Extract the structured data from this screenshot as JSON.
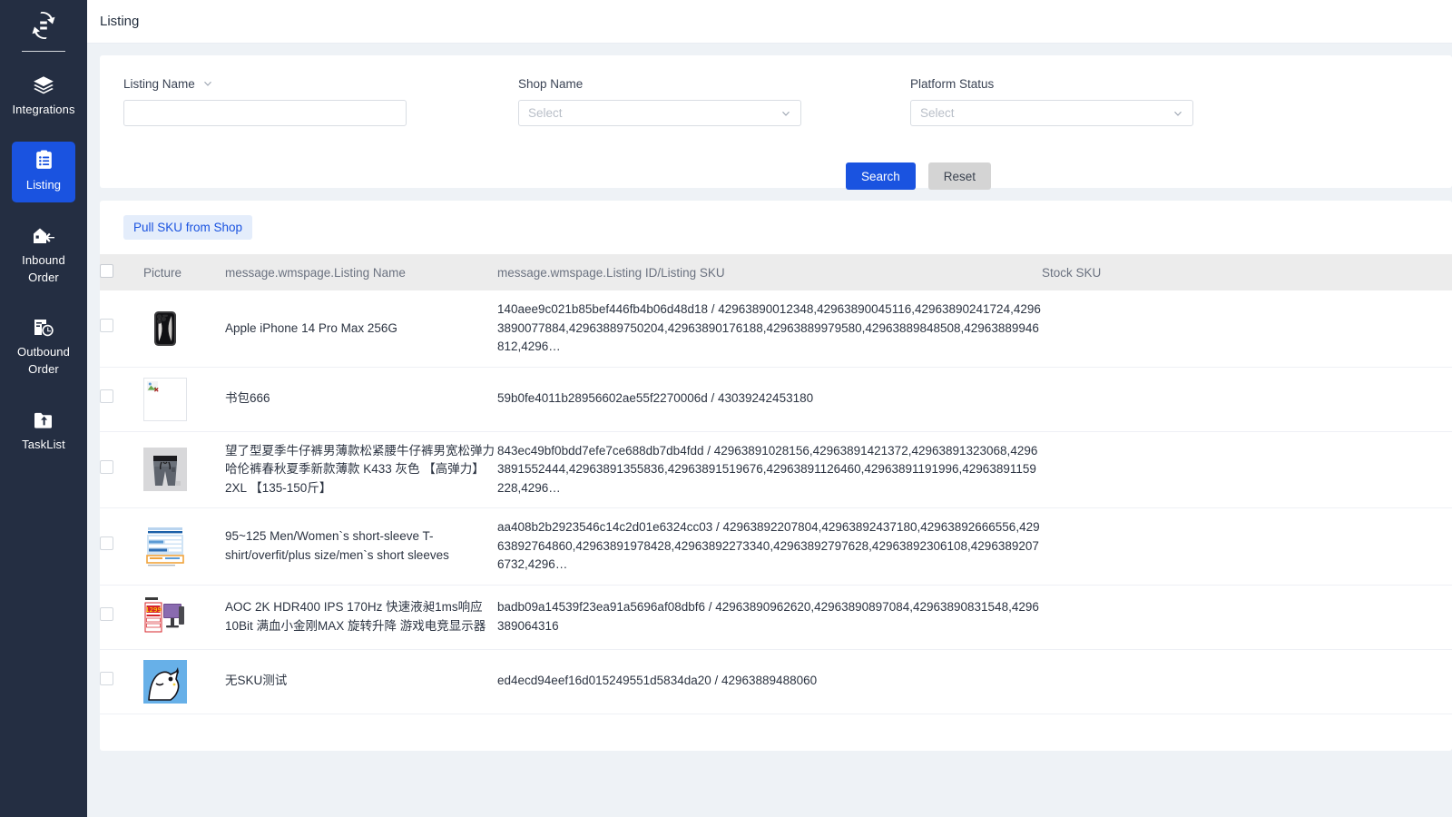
{
  "sidebar": {
    "logo_icon": "brand-sync-logo",
    "items": [
      {
        "id": "integrations",
        "label": "Integrations",
        "icon": "layers-icon",
        "active": false
      },
      {
        "id": "listing",
        "label": "Listing",
        "icon": "clipboard-list-icon",
        "active": true
      },
      {
        "id": "inbound-order",
        "label": "Inbound Order",
        "icon": "warehouse-inbound-icon",
        "active": false
      },
      {
        "id": "outbound-order",
        "label": "Outbound Order",
        "icon": "document-clock-icon",
        "active": false
      },
      {
        "id": "tasklist",
        "label": "TaskList",
        "icon": "folder-upload-icon",
        "active": false
      }
    ]
  },
  "header": {
    "title": "Listing"
  },
  "filters": {
    "listing_name": {
      "label": "Listing Name",
      "caret_icon": "chevron-down-icon",
      "value": "",
      "placeholder": ""
    },
    "shop_name": {
      "label": "Shop Name",
      "value": "",
      "placeholder": "Select",
      "caret_icon": "chevron-down-icon"
    },
    "platform_status": {
      "label": "Platform Status",
      "value": "",
      "placeholder": "Select",
      "caret_icon": "chevron-down-icon"
    },
    "search_label": "Search",
    "reset_label": "Reset",
    "accent_color": "#1a53e0",
    "reset_color": "#d4d4d4"
  },
  "toolbar": {
    "pull_sku_label": "Pull SKU from Shop",
    "pull_sku_bg": "#e4edfb",
    "pull_sku_fg": "#1a53e0"
  },
  "table": {
    "columns": [
      {
        "key": "checkbox",
        "label": ""
      },
      {
        "key": "picture",
        "label": "Picture"
      },
      {
        "key": "name",
        "label": "message.wmspage.Listing Name"
      },
      {
        "key": "id",
        "label": "message.wmspage.Listing ID/Listing SKU"
      },
      {
        "key": "stock_sku",
        "label": "Stock SKU"
      }
    ],
    "rows": [
      {
        "picture": "iphone-14-pro-max-thumbnail",
        "name": "Apple iPhone 14 Pro Max 256G",
        "id": "140aee9c021b85bef446fb4b06d48d18 / 42963890012348,42963890045116,42963890241724,42963890077884,42963889750204,42963890176188,42963889979580,42963889848508,42963889946812,4296…",
        "stock_sku": ""
      },
      {
        "picture": "broken-image-thumbnail",
        "name": "书包666",
        "id": "59b0fe4011b28956602ae55f2270006d / 43039242453180",
        "stock_sku": ""
      },
      {
        "picture": "grey-jeans-thumbnail",
        "name": "望了型夏季牛仔裤男薄款松紧腰牛仔裤男宽松弹力哈伦裤春秋夏季新款薄款 K433 灰色 【高弹力】 2XL 【135-150斤】",
        "id": "843ec49bf0bdd7efe7ce688db7db4fdd / 42963891028156,42963891421372,42963891323068,42963891552444,42963891355836,42963891519676,42963891126460,42963891191996,42963891159228,4296…",
        "stock_sku": ""
      },
      {
        "picture": "tshirt-size-chart-thumbnail",
        "name": "95~125 Men/Women`s short-sleeve T-shirt/overfit/plus size/men`s short sleeves",
        "id": "aa408b2b2923546c14c2d01e6324cc03 / 42963892207804,42963892437180,42963892666556,42963892764860,42963891978428,42963892273340,42963892797628,42963892306108,42963892076732,4296…",
        "stock_sku": ""
      },
      {
        "picture": "aoc-monitor-thumbnail",
        "name": "AOC 2K HDR400 IPS 170Hz 快速液昶1ms响应 10Bit 满血小金刚MAX 旋转升降 游戏电竞显示器",
        "id": "badb09a14539f23ea91a5696af08dbf6 / 42963890962620,42963890897084,42963890831548,4296389064316",
        "stock_sku": ""
      },
      {
        "picture": "dog-avatar-thumbnail",
        "name": "无SKU测试",
        "id": "ed4ecd94eef16d015249551d5834da20 / 42963889488060",
        "stock_sku": ""
      }
    ]
  }
}
